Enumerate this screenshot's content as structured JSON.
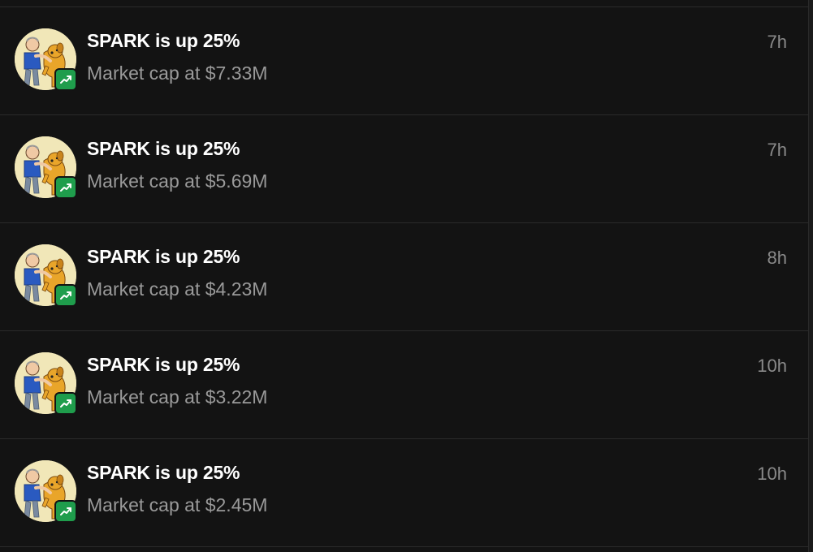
{
  "notifications": [
    {
      "title": "SPARK is up 25%",
      "subtitle": "Market cap at $7.33M",
      "time": "7h",
      "avatar_icon": "dog-and-man-avatar-icon",
      "badge_icon": "trending-up-icon"
    },
    {
      "title": "SPARK is up 25%",
      "subtitle": "Market cap at $5.69M",
      "time": "7h",
      "avatar_icon": "dog-and-man-avatar-icon",
      "badge_icon": "trending-up-icon"
    },
    {
      "title": "SPARK is up 25%",
      "subtitle": "Market cap at $4.23M",
      "time": "8h",
      "avatar_icon": "dog-and-man-avatar-icon",
      "badge_icon": "trending-up-icon"
    },
    {
      "title": "SPARK is up 25%",
      "subtitle": "Market cap at $3.22M",
      "time": "10h",
      "avatar_icon": "dog-and-man-avatar-icon",
      "badge_icon": "trending-up-icon"
    },
    {
      "title": "SPARK is up 25%",
      "subtitle": "Market cap at $2.45M",
      "time": "10h",
      "avatar_icon": "dog-and-man-avatar-icon",
      "badge_icon": "trending-up-icon"
    }
  ],
  "colors": {
    "background": "#131313",
    "divider": "#2a2a2a",
    "title": "#ffffff",
    "subtitle": "#9a9a9a",
    "time": "#8a8a8a",
    "badge": "#1f9d4c",
    "avatar_bg": "#f1e7b8"
  }
}
